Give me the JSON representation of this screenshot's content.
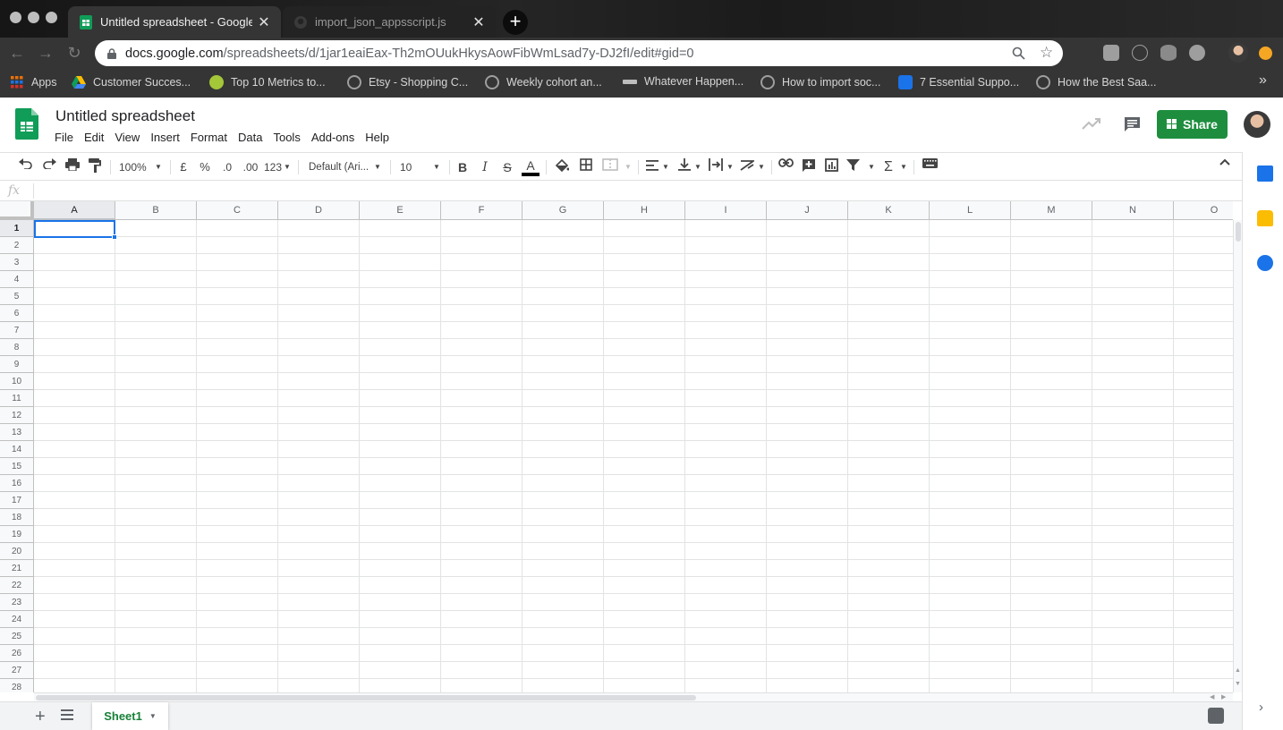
{
  "browser": {
    "tabs": [
      {
        "title": "Untitled spreadsheet - Google Sheets",
        "active": true
      },
      {
        "title": "import_json_appsscript.js",
        "active": false
      }
    ],
    "url_host": "docs.google.com",
    "url_path": "/spreadsheets/d/1jar1eaiEax-Th2mOUukHkysAowFibWmLsad7y-DJ2fI/edit#gid=0",
    "bookmarks": [
      {
        "label": "Apps"
      },
      {
        "label": "Customer Succes..."
      },
      {
        "label": "Top 10 Metrics to..."
      },
      {
        "label": "Etsy - Shopping C..."
      },
      {
        "label": "Weekly cohort an..."
      },
      {
        "label": "Whatever Happen..."
      },
      {
        "label": "How to import soc..."
      },
      {
        "label": "7 Essential Suppo..."
      },
      {
        "label": "How the Best Saa..."
      }
    ],
    "bookmarks_overflow": "»"
  },
  "sheets": {
    "doc_title": "Untitled spreadsheet",
    "menu": [
      "File",
      "Edit",
      "View",
      "Insert",
      "Format",
      "Data",
      "Tools",
      "Add-ons",
      "Help"
    ],
    "share_label": "Share",
    "toolbar": {
      "zoom": "100%",
      "currency": "£",
      "percent": "%",
      "dec_decrease": ".0",
      "dec_increase": ".00",
      "more_formats": "123",
      "font": "Default (Ari...",
      "font_size": "10",
      "bold": "B",
      "italic": "I",
      "strike": "S",
      "text_color": "A",
      "functions": "Σ"
    },
    "formula_label": "fx",
    "columns": [
      "A",
      "B",
      "C",
      "D",
      "E",
      "F",
      "G",
      "H",
      "I",
      "J",
      "K",
      "L",
      "M",
      "N",
      "O"
    ],
    "rows": [
      "1",
      "2",
      "3",
      "4",
      "5",
      "6",
      "7",
      "8",
      "9",
      "10",
      "11",
      "12",
      "13",
      "14",
      "15",
      "16",
      "17",
      "18",
      "19",
      "20",
      "21",
      "22",
      "23",
      "24",
      "25",
      "26",
      "27",
      "28"
    ],
    "selected_cell": "A1",
    "sheet_tabs": [
      {
        "name": "Sheet1"
      }
    ]
  },
  "colors": {
    "accent_green": "#1e8e3e",
    "selection_blue": "#1a73e8",
    "sheet_tab_green": "#188038"
  }
}
